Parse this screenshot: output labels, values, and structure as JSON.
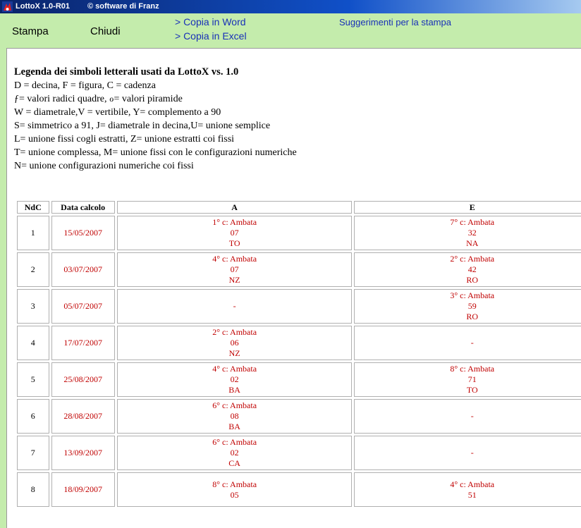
{
  "window": {
    "title": "LottoX 1.0-R01",
    "copyright": "© software di Franz"
  },
  "toolbar": {
    "stampa": "Stampa",
    "chiudi": "Chiudi",
    "word": "> Copia in Word",
    "excel": "> Copia in Excel",
    "suggerimenti": "Suggerimenti per la stampa"
  },
  "legend": {
    "title": "Legenda dei simboli letterali usati da LottoX vs. 1.0",
    "lines": [
      "D = decina, F = figura, C = cadenza",
      "ƒ= valori radici quadre, ℴ= valori piramide",
      "W = diametrale,V = vertibile, Y= complemento a 90",
      "S= simmetrico a 91, J= diametrale in decina,U= unione semplice",
      "L= unione fissi cogli estratti, Z= unione estratti coi fissi",
      "T= unione complessa, M= unione fissi con le configurazioni numeriche",
      "N= unione configurazioni numeriche coi fissi"
    ]
  },
  "table": {
    "headers": [
      "NdC",
      "Data calcolo",
      "A",
      "E"
    ],
    "rows": [
      {
        "ndc": "1",
        "date": "15/05/2007",
        "a": [
          "1° c: Ambata",
          "07",
          "TO"
        ],
        "e": [
          "7° c: Ambata",
          "32",
          "NA"
        ]
      },
      {
        "ndc": "2",
        "date": "03/07/2007",
        "a": [
          "4° c: Ambata",
          "07",
          "NZ"
        ],
        "e": [
          "2° c: Ambata",
          "42",
          "RO"
        ]
      },
      {
        "ndc": "3",
        "date": "05/07/2007",
        "a": [
          "-"
        ],
        "e": [
          "3° c: Ambata",
          "59",
          "RO"
        ]
      },
      {
        "ndc": "4",
        "date": "17/07/2007",
        "a": [
          "2° c: Ambata",
          "06",
          "NZ"
        ],
        "e": [
          "-"
        ]
      },
      {
        "ndc": "5",
        "date": "25/08/2007",
        "a": [
          "4° c: Ambata",
          "02",
          "BA"
        ],
        "e": [
          "8° c: Ambata",
          "71",
          "TO"
        ]
      },
      {
        "ndc": "6",
        "date": "28/08/2007",
        "a": [
          "6° c: Ambata",
          "08",
          "BA"
        ],
        "e": [
          "-"
        ]
      },
      {
        "ndc": "7",
        "date": "13/09/2007",
        "a": [
          "6° c: Ambata",
          "02",
          "CA"
        ],
        "e": [
          "-"
        ]
      },
      {
        "ndc": "8",
        "date": "18/09/2007",
        "a": [
          "8° c: Ambata",
          "05",
          ""
        ],
        "e": [
          "4° c: Ambata",
          "51",
          ""
        ]
      }
    ]
  },
  "colors": {
    "background": "#c4ecac",
    "accent": "#1830b8",
    "value": "#c00000"
  }
}
